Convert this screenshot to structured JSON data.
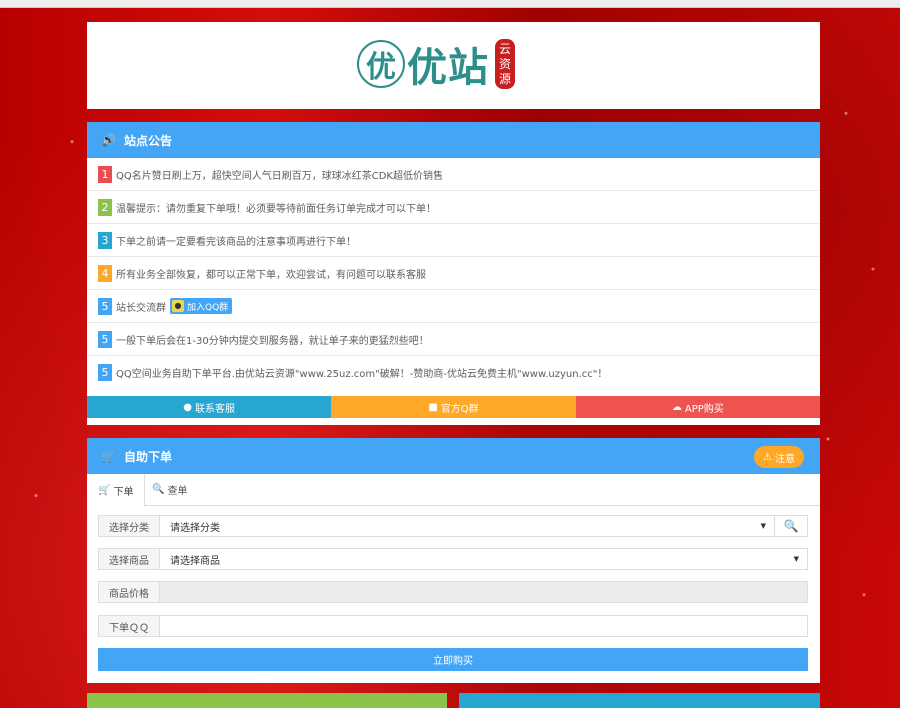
{
  "logo": {
    "circle_char": "优",
    "text": "优站",
    "seal_text": "云资源"
  },
  "notice": {
    "title": "站点公告",
    "icon": "volume-icon",
    "items": [
      {
        "num": "1",
        "color": "#e84e4e",
        "text": "QQ名片赞日刷上万，超快空间人气日刷百万，球球冰红茶CDK超低价销售"
      },
      {
        "num": "2",
        "color": "#8bc34a",
        "text": "温馨提示：请勿重复下单哦！必须要等待前面任务订单完成才可以下单！"
      },
      {
        "num": "3",
        "color": "#26a6d1",
        "text": "下单之前请一定要看完该商品的注意事项再进行下单！"
      },
      {
        "num": "4",
        "color": "#ffa726",
        "text": "所有业务全部恢复，都可以正常下单，欢迎尝试，有问题可以联系客服"
      },
      {
        "num": "5",
        "color": "#42a5f5",
        "text": "站长交流群",
        "qq_button": "加入QQ群"
      },
      {
        "num": "5",
        "color": "#42a5f5",
        "text": "一般下单后会在1-30分钟内提交到服务器，就让单子来的更猛烈些吧！"
      },
      {
        "num": "5",
        "color": "#42a5f5",
        "text": "QQ空间业务自助下单平台.由优站云资源\"www.25uz.com\"破解！-赞助商-优站云免费主机\"www.uzyun.cc\"！"
      }
    ],
    "buttons": [
      {
        "label": "联系客服",
        "color": "#26a6d1",
        "icon": "qq-icon"
      },
      {
        "label": "官方Q群",
        "color": "#ffa726",
        "icon": "group-icon"
      },
      {
        "label": "APP购买",
        "color": "#ef5350",
        "icon": "cloud-download-icon"
      }
    ]
  },
  "order": {
    "title": "自助下单",
    "warn_label": "注意",
    "tabs": [
      {
        "label": "下单",
        "icon": "cart-icon"
      },
      {
        "label": "查单",
        "icon": "search-icon"
      }
    ],
    "fields": {
      "category_label": "选择分类",
      "category_value": "请选择分类",
      "product_label": "选择商品",
      "product_value": "请选择商品",
      "price_label": "商品价格",
      "price_value": "",
      "qq_label": "下单ＱＱ",
      "qq_value": ""
    },
    "buy_label": "立即购买"
  },
  "colors": {
    "primary": "#42a5f5",
    "logo_teal": "#2e8f8a",
    "seal_red": "#c71f1f"
  }
}
